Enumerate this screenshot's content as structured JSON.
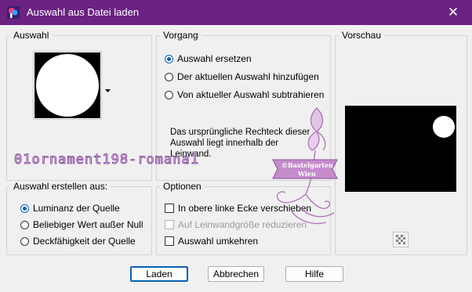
{
  "window": {
    "title": "Auswahl aus Datei laden",
    "close_glyph": "✕"
  },
  "auswahl": {
    "legend": "Auswahl"
  },
  "vorgang": {
    "legend": "Vorgang",
    "options": [
      "Auswahl ersetzen",
      "Der aktuellen Auswahl hinzufügen",
      "Von aktueller Auswahl subtrahieren"
    ],
    "selected": 0,
    "note_lines": [
      "Das ursprüngliche Rechteck dieser",
      "Auswahl liegt innerhalb der",
      "Leinwand."
    ]
  },
  "vorschau": {
    "legend": "Vorschau"
  },
  "erstellen": {
    "legend": "Auswahl erstellen aus:",
    "options": [
      "Luminanz der Quelle",
      "Beliebiger Wert außer Null",
      "Deckfähigkeit der Quelle"
    ],
    "selected": 0
  },
  "optionen": {
    "legend": "Optionen",
    "checks": [
      "In obere linke Ecke verschieben",
      "Auf Leinwandgröße reduzieren",
      "Auswahl umkehren"
    ]
  },
  "overlay": {
    "selection_name": "01ornament198-romana1",
    "watermark_line1": "©Bastelgarten",
    "watermark_line2": "Wien"
  },
  "buttons": {
    "load": "Laden",
    "cancel": "Abbrechen",
    "help": "Hilfe"
  },
  "colors": {
    "titlebar": "#6b2283",
    "accent": "#0a5fb4",
    "watermark": "#b07ab6"
  }
}
